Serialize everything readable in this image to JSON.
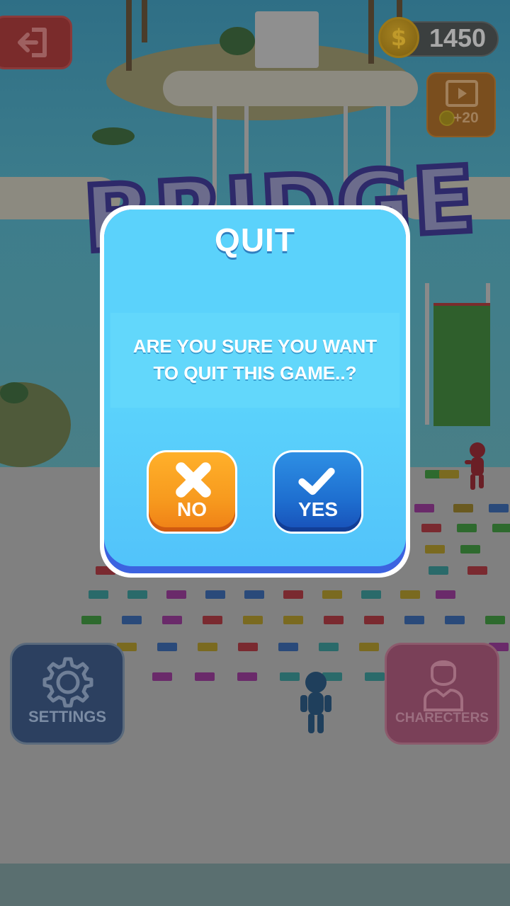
{
  "hud": {
    "coins": "1450",
    "coin_symbol": "$",
    "video_reward": "+20",
    "settings_label": "SETTINGS",
    "characters_label": "CHARECTERS",
    "exit_icon": "exit-icon",
    "video_icon": "video-icon",
    "gear_icon": "gear-icon",
    "character_icon": "character-icon"
  },
  "background": {
    "logo_text": "BRIDGE"
  },
  "dialog": {
    "title": "QUIT",
    "message_line1": "ARE YOU SURE YOU WANT",
    "message_line2": "TO QUIT THIS GAME..?",
    "no_label": "NO",
    "yes_label": "YES",
    "no_icon": "close-icon",
    "yes_icon": "check-icon",
    "colors": {
      "panel": "#5bd2fb",
      "no_button": "#f79a1e",
      "yes_button": "#1e6fd0"
    }
  }
}
